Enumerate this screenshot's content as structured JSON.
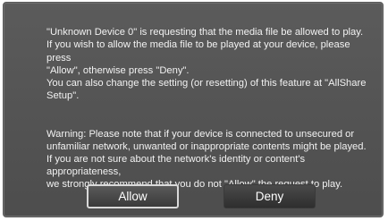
{
  "dialog": {
    "paragraphs": [
      "\"Unknown Device 0\" is requesting that the media file be allowed to play.\nIf you wish to allow the media file to be played at your device, please press\n\"Allow\", otherwise press \"Deny\".\nYou can also change the setting (or resetting) of this feature at \"AllShare\nSetup\".",
      "Warning: Please note that if your device is connected to unsecured or\nunfamiliar network, unwanted or inappropriate contents might be played.\nIf you are not sure about the network's identity or content's appropriateness,\nwe strongly recommend that you do not \"Allow\" the request to play."
    ],
    "buttons": {
      "allow_label": "Allow",
      "deny_label": "Deny",
      "focused": "Allow"
    },
    "colors": {
      "background": "#555555",
      "text": "#f2f2f2",
      "focus_border": "#d9d9d9"
    }
  }
}
